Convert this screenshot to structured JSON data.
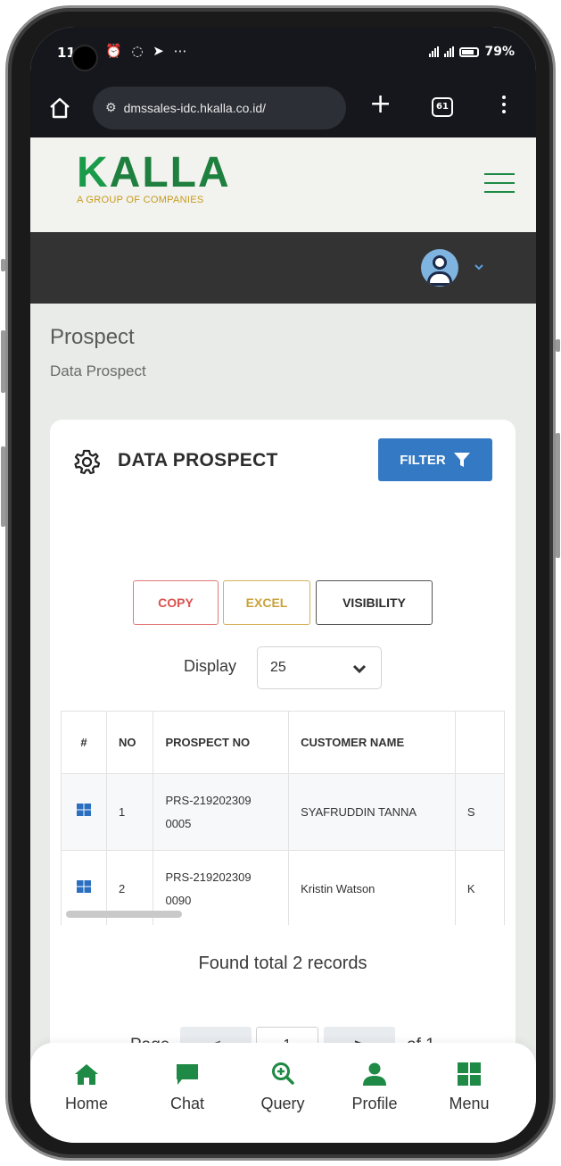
{
  "status_bar": {
    "time": "11",
    "battery": "79%"
  },
  "browser": {
    "url": "dmssales-idc.hkalla.co.id/",
    "tab_count": "61"
  },
  "logo": {
    "word_first": "K",
    "word_rest": "ALLA",
    "tagline": "A GROUP OF COMPANIES"
  },
  "page": {
    "title": "Prospect",
    "subtitle": "Data Prospect"
  },
  "card": {
    "title": "DATA PROSPECT",
    "filter_label": "FILTER",
    "buttons": {
      "copy": "COPY",
      "excel": "EXCEL",
      "visibility": "VISIBILITY"
    },
    "display_label": "Display",
    "display_value": "25"
  },
  "table": {
    "headers": [
      "#",
      "NO",
      "PROSPECT NO",
      "CUSTOMER NAME",
      ""
    ],
    "rows": [
      {
        "no": "1",
        "prospect_no_line1": "PRS-219202309",
        "prospect_no_line2": "0005",
        "customer": "SYAFRUDDIN TANNA",
        "extra": "S"
      },
      {
        "no": "2",
        "prospect_no_line1": "PRS-219202309",
        "prospect_no_line2": "0090",
        "customer": "Kristin Watson",
        "extra": "K"
      }
    ]
  },
  "summary": {
    "found_text": "Found total 2 records"
  },
  "pagination": {
    "page_label": "Page",
    "prev": "<",
    "current": "1",
    "next": ">",
    "of_label": "of 1"
  },
  "bottom_nav": {
    "items": [
      {
        "label": "Home"
      },
      {
        "label": "Chat"
      },
      {
        "label": "Query"
      },
      {
        "label": "Profile"
      },
      {
        "label": "Menu"
      }
    ]
  },
  "colors": {
    "brand_green": "#1f8a45",
    "brand_gold": "#c69a1c",
    "primary_blue": "#3479c4",
    "copy_red": "#d9534f",
    "excel_gold": "#c9a23a"
  }
}
